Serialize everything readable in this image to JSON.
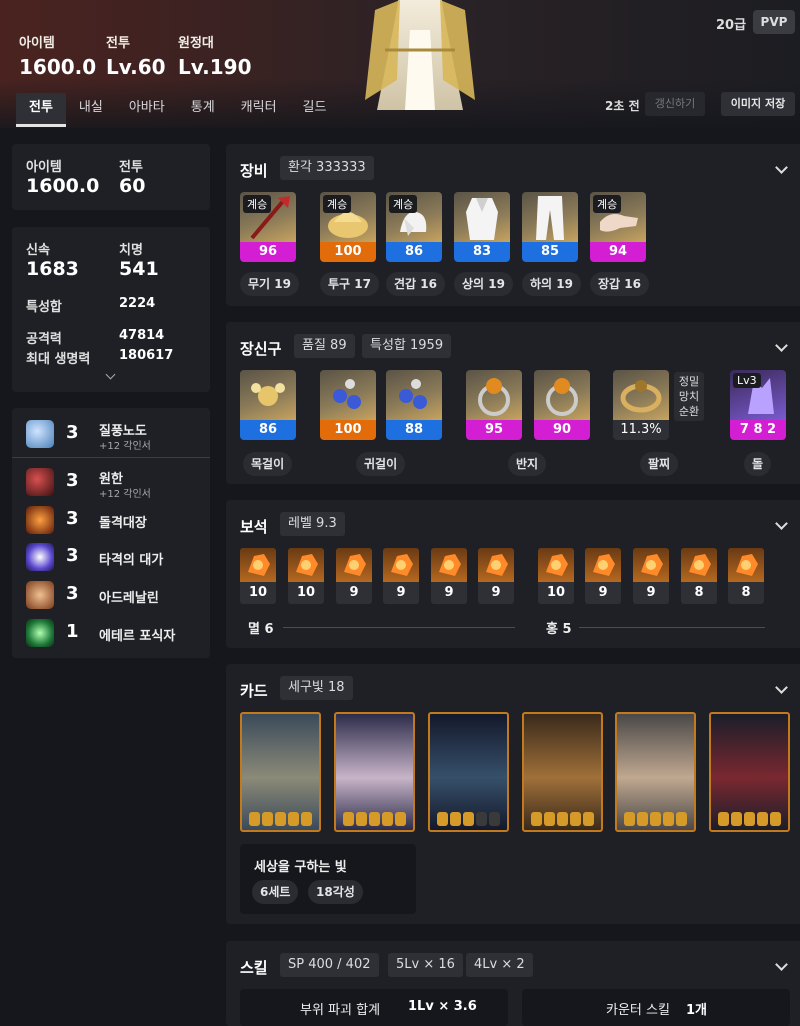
{
  "header": {
    "stats": [
      {
        "label": "아이템",
        "value": "1600.0"
      },
      {
        "label": "전투",
        "value": "Lv.60"
      },
      {
        "label": "원정대",
        "value": "Lv.190"
      }
    ],
    "grade": "20급",
    "pvp": "PVP",
    "tabs": [
      "전투",
      "내실",
      "아바타",
      "통계",
      "캐릭터",
      "길드"
    ],
    "updated": "2초 전",
    "refresh": "갱신하기",
    "save_image": "이미지 저장"
  },
  "left": {
    "summary": [
      {
        "label": "아이템",
        "value": "1600.0"
      },
      {
        "label": "전투",
        "value": "60"
      }
    ],
    "combat": {
      "swiftness_label": "신속",
      "swiftness": "1683",
      "crit_label": "치명",
      "crit": "541",
      "trait_label": "특성합",
      "trait": "2224",
      "atk_label": "공격력",
      "atk": "47814",
      "hp_label": "최대 생명력",
      "hp": "180617"
    },
    "engravings": [
      {
        "level": "3",
        "name": "질풍노도",
        "sub": "+12 각인서",
        "color": "#6aa0d8"
      },
      {
        "level": "3",
        "name": "원한",
        "sub": "+12 각인서",
        "color": "#7a2a2a"
      },
      {
        "level": "3",
        "name": "돌격대장",
        "sub": "",
        "color": "#b0401c"
      },
      {
        "level": "3",
        "name": "타격의 대가",
        "sub": "",
        "color": "#7f6cf0"
      },
      {
        "level": "3",
        "name": "아드레날린",
        "sub": "",
        "color": "#a85c34"
      },
      {
        "level": "1",
        "name": "에테르 포식자",
        "sub": "",
        "color": "#2f9a5a"
      }
    ]
  },
  "equipment": {
    "title": "장비",
    "chip": "환각 333333",
    "items": [
      {
        "tag": "계승",
        "quality": "96",
        "color": "#d41ed4",
        "label": "무기 19"
      },
      {
        "tag": "계승",
        "quality": "100",
        "color": "#e36c0a",
        "label": "투구 17"
      },
      {
        "tag": "계승",
        "quality": "86",
        "color": "#1e6fe0",
        "label": "견갑 16"
      },
      {
        "tag": "",
        "quality": "83",
        "color": "#1e6fe0",
        "label": "상의 19"
      },
      {
        "tag": "",
        "quality": "85",
        "color": "#1e6fe0",
        "label": "하의 19"
      },
      {
        "tag": "계승",
        "quality": "94",
        "color": "#d41ed4",
        "label": "장갑 16"
      }
    ]
  },
  "accessories": {
    "title": "장신구",
    "chip1": "품질 89",
    "chip2": "특성합 1959",
    "items": [
      {
        "quality": "86",
        "color": "#1e6fe0"
      },
      {
        "quality": "100",
        "color": "#e36c0a"
      },
      {
        "quality": "88",
        "color": "#1e6fe0"
      },
      {
        "quality": "95",
        "color": "#d41ed4"
      },
      {
        "quality": "90",
        "color": "#d41ed4"
      },
      {
        "quality": "11.3%",
        "color": "#2e3036"
      },
      {
        "quality": "7 8 2",
        "color": "#d41ed4",
        "tag": "Lv3"
      }
    ],
    "bracelet_note": [
      "정밀",
      "망치",
      "순환"
    ],
    "labels": [
      "목걸이",
      "귀걸이",
      "반지",
      "팔찌",
      "돌"
    ]
  },
  "gems": {
    "title": "보석",
    "chip": "레벨 9.3",
    "values": [
      "10",
      "10",
      "9",
      "9",
      "9",
      "9",
      "10",
      "9",
      "9",
      "8",
      "8"
    ],
    "group1": "멸 6",
    "group2": "홍 5"
  },
  "cards": {
    "title": "카드",
    "chip": "세구빛 18",
    "set_name": "세상을 구하는 빛",
    "set_pill1": "6세트",
    "set_pill2": "18각성",
    "colors": [
      [
        "#3a4a5a",
        "#8c8a78"
      ],
      [
        "#2c2c4a",
        "#c8b4c8"
      ],
      [
        "#14182a",
        "#36506a"
      ],
      [
        "#3a2a1a",
        "#a0703a"
      ],
      [
        "#4a4848",
        "#c0a890"
      ],
      [
        "#1a1e2a",
        "#7a2830"
      ]
    ]
  },
  "skills": {
    "title": "스킬",
    "chip1": "SP 400 / 402",
    "chip2": "5Lv × 16",
    "chip3": "4Lv × 2",
    "box1_label": "부위 파괴 합계",
    "box1_value": "1Lv × 3.6",
    "box2_label": "카운터 스킬",
    "box2_value": "1개"
  }
}
